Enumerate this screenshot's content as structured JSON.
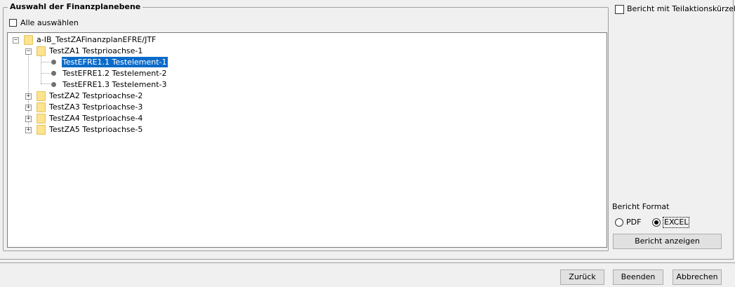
{
  "group": {
    "title": "Auswahl der Finanzplanebene",
    "select_all_label": "Alle auswählen",
    "select_all_checked": false
  },
  "tree": {
    "root": {
      "label": "a-IB_TestZAFinanzplanEFRE/JTF",
      "expanded": true
    },
    "nodes": [
      {
        "label": "TestZA1 Testprioachse-1",
        "expanded": true,
        "children": [
          {
            "label": "TestEFRE1.1 Testelement-1",
            "selected": true
          },
          {
            "label": "TestEFRE1.2 Testelement-2",
            "selected": false
          },
          {
            "label": "TestEFRE1.3 Testelement-3",
            "selected": false
          }
        ]
      },
      {
        "label": "TestZA2 Testprioachse-2",
        "expanded": false
      },
      {
        "label": "TestZA3 Testprioachse-3",
        "expanded": false
      },
      {
        "label": "TestZA4 Testprioachse-4",
        "expanded": false
      },
      {
        "label": "TestZA5 Testprioachse-5",
        "expanded": false
      }
    ]
  },
  "options": {
    "teilaktion_label": "Bericht mit Teilaktionskürzel",
    "teilaktion_checked": false,
    "format_label": "Bericht Format",
    "format_pdf_label": "PDF",
    "format_excel_label": "EXCEL",
    "format_selected": "EXCEL",
    "show_report_label": "Bericht anzeigen"
  },
  "footer": {
    "back_label": "Zurück",
    "finish_label": "Beenden",
    "cancel_label": "Abbrechen"
  },
  "colors": {
    "selection": "#0b6bc8",
    "folder": "#fbe38f"
  }
}
